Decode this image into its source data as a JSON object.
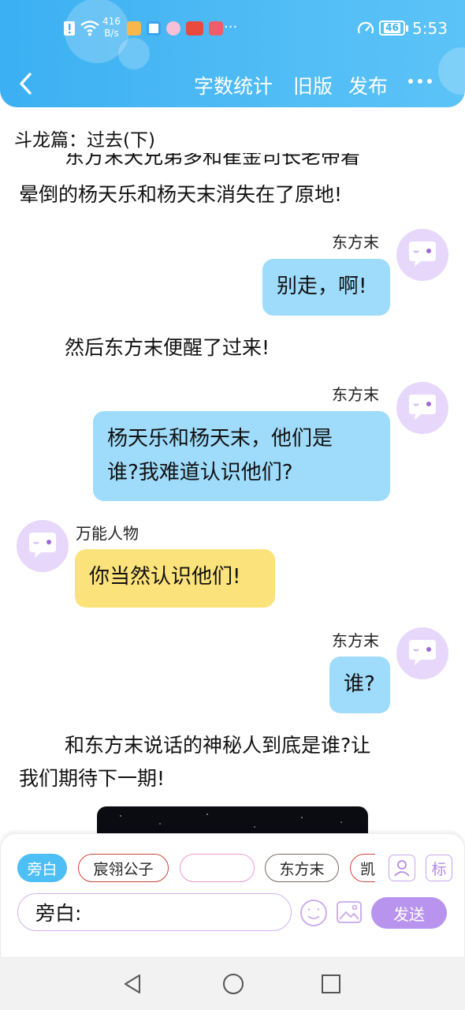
{
  "status_bar": {
    "network_speed_value": "416",
    "network_speed_unit": "B/s",
    "more_glyph": "···",
    "battery": "46",
    "time": "5:53"
  },
  "nav": {
    "word_count": "字数统计",
    "old_version": "旧版",
    "publish": "发布"
  },
  "story": {
    "title": "斗龙篇：过去(下)",
    "partial_top_line": "东方末天兄弟多和崔金司长老带着",
    "para_1": "晕倒的杨天乐和杨天末消失在了原地!",
    "para_2": "然后东方末便醒了过来!",
    "para_3_line1": "和东方末说话的神秘人到底是谁?让",
    "para_3_line2": "我们期待下一期!"
  },
  "messages": [
    {
      "speaker": "东方末",
      "lines": [
        "别走，啊!"
      ],
      "side": "right"
    },
    {
      "speaker": "东方末",
      "lines": [
        "杨天乐和杨天末，他们是",
        "谁?我难道认识他们?"
      ],
      "side": "right"
    },
    {
      "speaker": "万能人物",
      "lines": [
        "你当然认识他们!"
      ],
      "side": "left"
    },
    {
      "speaker": "东方末",
      "lines": [
        "谁?"
      ],
      "side": "right"
    }
  ],
  "composer": {
    "chips": [
      "旁白",
      "宸翎公子",
      "",
      "东方末",
      "凯"
    ],
    "role_icon": "person-icon",
    "mark_label": "标",
    "input_value": "旁白:",
    "send_label": "发送"
  },
  "colors": {
    "header": "#4db8f4",
    "bubble_blue": "#9fdcfb",
    "bubble_yellow": "#fbe27a",
    "accent_purple": "#b894ee",
    "chip_red": "#c9443b"
  }
}
